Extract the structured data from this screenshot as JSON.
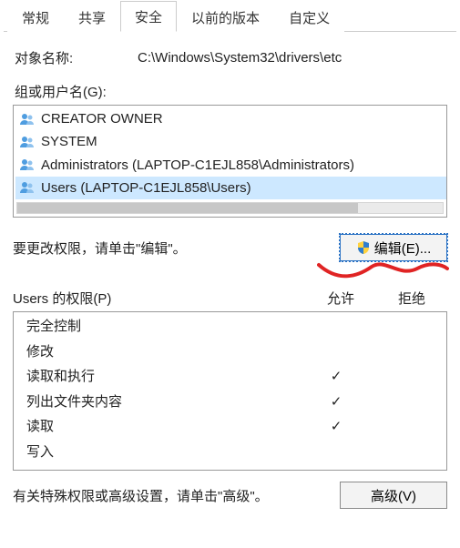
{
  "tabs": [
    {
      "label": "常规",
      "active": false
    },
    {
      "label": "共享",
      "active": false
    },
    {
      "label": "安全",
      "active": true
    },
    {
      "label": "以前的版本",
      "active": false
    },
    {
      "label": "自定义",
      "active": false
    }
  ],
  "object": {
    "label": "对象名称:",
    "value": "C:\\Windows\\System32\\drivers\\etc"
  },
  "groups": {
    "label": "组或用户名(G):",
    "items": [
      {
        "name": "CREATOR OWNER",
        "selected": false
      },
      {
        "name": "SYSTEM",
        "selected": false
      },
      {
        "name": "Administrators (LAPTOP-C1EJL858\\Administrators)",
        "selected": false
      },
      {
        "name": "Users (LAPTOP-C1EJL858\\Users)",
        "selected": true
      }
    ]
  },
  "edit": {
    "text": "要更改权限，请单击\"编辑\"。",
    "button": "编辑(E)..."
  },
  "perms": {
    "title": "Users 的权限(P)",
    "allow": "允许",
    "deny": "拒绝",
    "rows": [
      {
        "name": "完全控制",
        "allow": false,
        "deny": false
      },
      {
        "name": "修改",
        "allow": false,
        "deny": false
      },
      {
        "name": "读取和执行",
        "allow": true,
        "deny": false
      },
      {
        "name": "列出文件夹内容",
        "allow": true,
        "deny": false
      },
      {
        "name": "读取",
        "allow": true,
        "deny": false
      },
      {
        "name": "写入",
        "allow": false,
        "deny": false
      }
    ]
  },
  "advanced": {
    "text": "有关特殊权限或高级设置，请单击\"高级\"。",
    "button": "高级(V)"
  },
  "check": "✓"
}
